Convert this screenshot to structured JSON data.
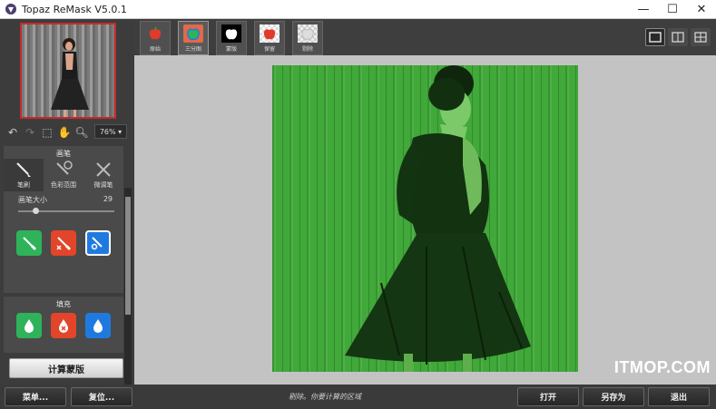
{
  "window": {
    "title": "Topaz ReMask V5.0.1",
    "minimize": "—",
    "maximize": "☐",
    "close": "✕"
  },
  "left_panel": {
    "zoom": "76%",
    "brush_section_title": "画笔",
    "brush_types": [
      {
        "label": "笔刷",
        "icon": "brush-icon"
      },
      {
        "label": "色彩范围",
        "icon": "color-range-icon"
      },
      {
        "label": "微调笔",
        "icon": "refine-icon"
      }
    ],
    "brush_size_label": "画笔大小",
    "brush_size_value": "29",
    "brush_size_fraction": 0.18,
    "fill_section_title": "填充",
    "compute_button": "计算蒙版"
  },
  "tabs": [
    {
      "label": "原始",
      "icon": "apple-icon"
    },
    {
      "label": "三分图",
      "icon": "trimap-icon"
    },
    {
      "label": "蒙版",
      "icon": "mask-icon"
    },
    {
      "label": "保留",
      "icon": "keep-icon"
    },
    {
      "label": "剔除",
      "icon": "cutout-icon"
    }
  ],
  "bottom": {
    "menu_button": "菜单...",
    "reset_button": "复位...",
    "status": "剔除。你要计算的区域",
    "open_button": "打开",
    "save_as_button": "另存为",
    "exit_button": "退出"
  },
  "watermark": "ITMOP.COM",
  "colors": {
    "keep_green": "#2fb35a",
    "drop_red": "#e2452a",
    "compute_blue": "#1f7ae0",
    "mask_overlay": "#41a83a"
  }
}
